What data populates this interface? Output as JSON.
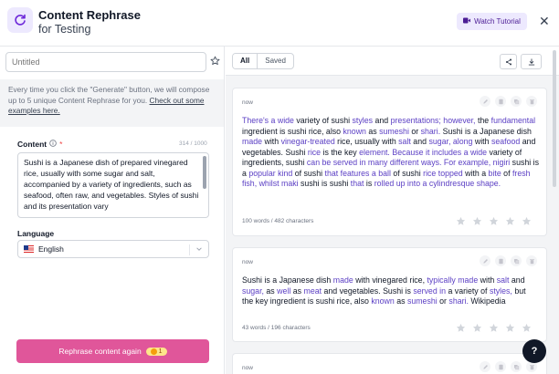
{
  "header": {
    "title": "Content Rephrase",
    "subtitle": "for Testing",
    "watch_tutorial_label": "Watch Tutorial",
    "close_glyph": "✕",
    "accent_color": "#ede9fe"
  },
  "left_panel": {
    "title_placeholder": "Untitled",
    "info_text": "Every time you click the \"Generate\" button, we will compose up to 5 unique Content Rephrase for you.",
    "info_link": "Check out some examples here.",
    "content_label": "Content",
    "content_required_mark": "*",
    "char_count": "314 / 1000",
    "content_value": "Sushi is a Japanese dish of prepared vinegared rice, usually with some sugar and salt, accompanied by a variety of ingredients, such as seafood, often raw, and vegetables. Styles of sushi and its presentation vary",
    "language_label": "Language",
    "language_value": "English",
    "generate_button_label": "Rephrase content again",
    "credit_count": "1",
    "button_color": "#e0569a"
  },
  "right_panel": {
    "tabs": [
      {
        "label": "All",
        "active": true
      },
      {
        "label": "Saved",
        "active": false
      }
    ],
    "results": [
      {
        "time": "now",
        "segments": [
          [
            "There's a",
            1
          ],
          [
            " ",
            0
          ],
          [
            "wide",
            1
          ],
          [
            " variety of sushi ",
            0
          ],
          [
            "styles",
            1
          ],
          [
            " and ",
            0
          ],
          [
            "presentations; however,",
            1
          ],
          [
            " the ",
            0
          ],
          [
            "fundamental",
            1
          ],
          [
            " ingredient is sushi rice, also ",
            0
          ],
          [
            "known",
            1
          ],
          [
            " as ",
            0
          ],
          [
            "sumeshi",
            1
          ],
          [
            " or ",
            0
          ],
          [
            "shari.",
            1
          ],
          [
            " Sushi is a Japanese dish ",
            0
          ],
          [
            "made",
            1
          ],
          [
            " with ",
            0
          ],
          [
            "vinegar-treated",
            1
          ],
          [
            " rice, usually with ",
            0
          ],
          [
            "salt",
            1
          ],
          [
            " and ",
            0
          ],
          [
            "sugar,",
            1
          ],
          [
            " ",
            0
          ],
          [
            "along",
            1
          ],
          [
            " with ",
            0
          ],
          [
            "seafood",
            1
          ],
          [
            " and vegetables. Sushi ",
            0
          ],
          [
            "rice",
            1
          ],
          [
            " is the key ",
            0
          ],
          [
            "element.",
            1
          ],
          [
            " ",
            0
          ],
          [
            "Because it includes a",
            1
          ],
          [
            " ",
            0
          ],
          [
            "wide",
            1
          ],
          [
            " variety of ingredients, sushi ",
            0
          ],
          [
            "can be",
            1
          ],
          [
            " ",
            0
          ],
          [
            "served in many different ways. For example, nigiri",
            1
          ],
          [
            " sushi is a ",
            0
          ],
          [
            "popular",
            1
          ],
          [
            " ",
            0
          ],
          [
            "kind",
            1
          ],
          [
            " of sushi ",
            0
          ],
          [
            "that features a",
            1
          ],
          [
            " ",
            0
          ],
          [
            "ball",
            1
          ],
          [
            " of sushi ",
            0
          ],
          [
            "rice topped",
            1
          ],
          [
            " with a ",
            0
          ],
          [
            "bite",
            1
          ],
          [
            " of ",
            0
          ],
          [
            "fresh fish, whilst maki",
            1
          ],
          [
            " sushi is sushi ",
            0
          ],
          [
            "that",
            1
          ],
          [
            " is ",
            0
          ],
          [
            "rolled up into a cylindresque shape.",
            1
          ]
        ],
        "meta": "100 words / 482 characters",
        "rating": 0
      },
      {
        "time": "now",
        "segments": [
          [
            "Sushi is a Japanese dish ",
            0
          ],
          [
            "made",
            1
          ],
          [
            " with vinegared rice, ",
            0
          ],
          [
            "typically made",
            1
          ],
          [
            " with ",
            0
          ],
          [
            "salt",
            1
          ],
          [
            " and ",
            0
          ],
          [
            "sugar,",
            1
          ],
          [
            " as ",
            0
          ],
          [
            "well",
            1
          ],
          [
            " as ",
            0
          ],
          [
            "meat",
            1
          ],
          [
            " and vegetables. Sushi is ",
            0
          ],
          [
            "served in",
            1
          ],
          [
            " a variety of ",
            0
          ],
          [
            "styles,",
            1
          ],
          [
            " but the key ingredient is sushi rice, also ",
            0
          ],
          [
            "known",
            1
          ],
          [
            " as ",
            0
          ],
          [
            "sumeshi",
            1
          ],
          [
            " or ",
            0
          ],
          [
            "shari.",
            1
          ],
          [
            " Wikipedia",
            0
          ]
        ],
        "meta": "43 words / 196 characters",
        "rating": 0
      },
      {
        "time": "now",
        "segments": [],
        "meta": "",
        "rating": 0
      }
    ]
  },
  "help": {
    "label": "?"
  },
  "icons": [
    "refresh-icon",
    "video-icon",
    "close-icon",
    "star-icon",
    "info-icon",
    "chevron-down-icon",
    "share-icon",
    "download-icon",
    "edit-icon",
    "copy-icon",
    "trash-icon",
    "save-icon",
    "coin-icon"
  ]
}
